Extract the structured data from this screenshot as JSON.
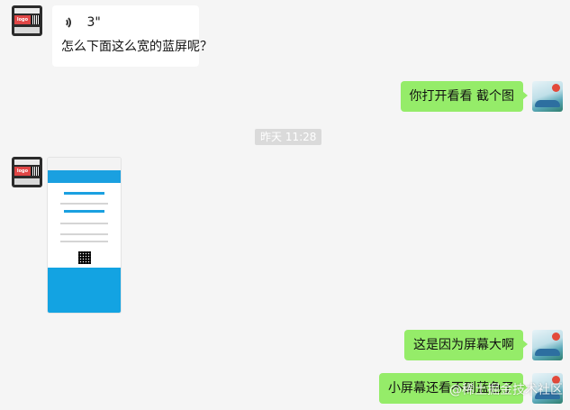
{
  "messages": [
    {
      "side": "left",
      "type": "voice",
      "duration": "3\"",
      "text": "怎么下面这么宽的蓝屏呢？"
    },
    {
      "side": "right",
      "type": "text",
      "text": "你打开看看 截个图"
    },
    {
      "side": "left",
      "type": "image"
    },
    {
      "side": "right",
      "type": "text",
      "text": "这是因为屏幕大啊"
    },
    {
      "side": "right",
      "type": "text",
      "text": "小屏幕还看不到蓝色了"
    }
  ],
  "timestamp": "昨天 11:28",
  "avatar_left_logo_text": "logo",
  "watermark": "@稀土掘金技术社区",
  "colors": {
    "green_bubble": "#95ec69",
    "background": "#f5f5f5",
    "image_blue": "#13a3e2"
  }
}
